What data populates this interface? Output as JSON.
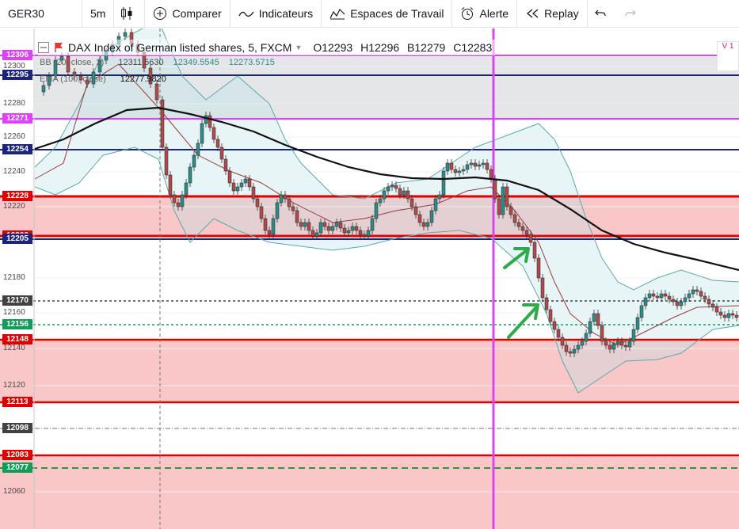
{
  "toolbar": {
    "symbol": "GER30",
    "interval": "5m",
    "compare_label": "Comparer",
    "indicators_label": "Indicateurs",
    "workspaces_label": "Espaces de Travail",
    "alert_label": "Alerte",
    "replay_label": "Replay"
  },
  "legend": {
    "title": "DAX Index of German listed shares, 5, FXCM",
    "open": "O12293",
    "high": "H12296",
    "low": "B12279",
    "close": "C12283",
    "bb_label": "BB (20, close, 2)",
    "bb_v1": "12311.5630",
    "bb_v2": "12349.5545",
    "bb_v3": "12273.5715",
    "ema_label": "EMA (100, close)",
    "ema_v": "12277.9820"
  },
  "axis_ticks": [
    "12300",
    "12280",
    "12260",
    "12240",
    "12220",
    "12180",
    "12160",
    "12140",
    "12120",
    "12060"
  ],
  "price_tags": [
    {
      "label": "12306",
      "color": "#e040fb"
    },
    {
      "label": "12295",
      "color": "#1a237e"
    },
    {
      "label": "12271",
      "color": "#e040fb"
    },
    {
      "label": "12254",
      "color": "#1a237e"
    },
    {
      "label": "12228",
      "color": "#e00000"
    },
    {
      "label": "12206",
      "color": "#e00000"
    },
    {
      "label": "12205",
      "color": "#1a237e"
    },
    {
      "label": "12170",
      "color": "#424242"
    },
    {
      "label": "12156",
      "color": "#0f9d58"
    },
    {
      "label": "12148",
      "color": "#e00000"
    },
    {
      "label": "12113",
      "color": "#e00000"
    },
    {
      "label": "12098",
      "color": "#424242"
    },
    {
      "label": "12083",
      "color": "#e00000"
    },
    {
      "label": "12077",
      "color": "#0f9d58"
    }
  ],
  "right_badge": "V 1",
  "colors": {
    "magenta": "#e040fb",
    "navy": "#1a237e",
    "red": "#e00000",
    "green_dash": "#0f9d58",
    "zone_fill": "#f9c7c7",
    "candle_up": "#2e8b87",
    "candle_down": "#b14a4a"
  }
}
